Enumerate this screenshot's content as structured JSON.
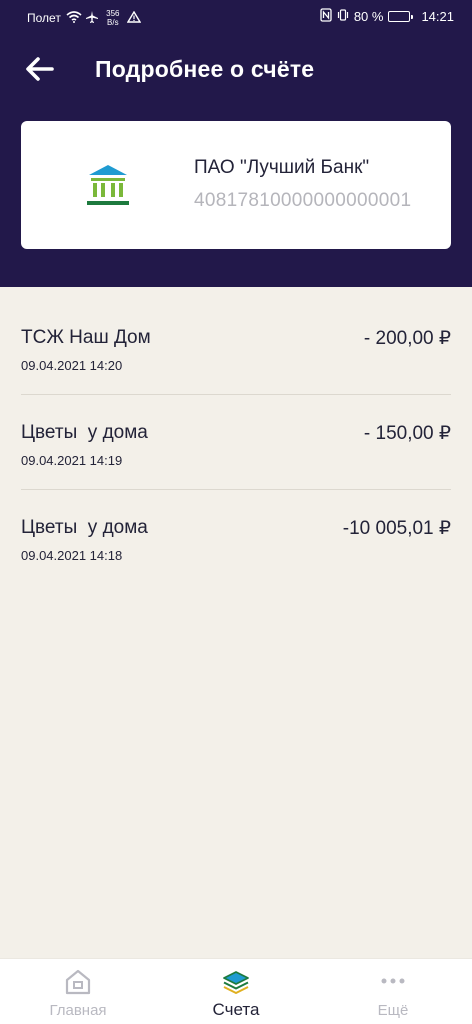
{
  "status_bar": {
    "carrier": "Полет",
    "speed_value": "356",
    "speed_unit": "B/s",
    "battery_percent": "80 %",
    "battery_level": 0.8,
    "time": "14:21"
  },
  "header": {
    "title": "Подробнее о счёте",
    "back_icon": "arrow-left-icon"
  },
  "account": {
    "bank_name": "ПАО \"Лучший Банк\"",
    "number": "40817810000000000001",
    "icon": "bank-building-icon",
    "icon_colors": [
      "#1f9bd1",
      "#7bb83a",
      "#1d7a3e"
    ]
  },
  "transactions": [
    {
      "name": "ТСЖ Наш Дом",
      "date": "09.04.2021 14:20",
      "amount": "- 200,00 ₽"
    },
    {
      "name": "Цветы  у дома",
      "date": "09.04.2021 14:19",
      "amount": "- 150,00 ₽"
    },
    {
      "name": "Цветы  у дома",
      "date": "09.04.2021 14:18",
      "amount": "-10 005,01 ₽"
    }
  ],
  "bottom_nav": {
    "items": [
      {
        "label": "Главная",
        "icon": "home-icon",
        "active": false
      },
      {
        "label": "Счета",
        "icon": "layers-icon",
        "active": true
      },
      {
        "label": "Ещё",
        "icon": "more-dots-icon",
        "active": false
      }
    ]
  },
  "colors": {
    "header_bg": "#22184a",
    "page_bg": "#f3f0e9",
    "text": "#232338",
    "muted": "#b5b5bb"
  }
}
